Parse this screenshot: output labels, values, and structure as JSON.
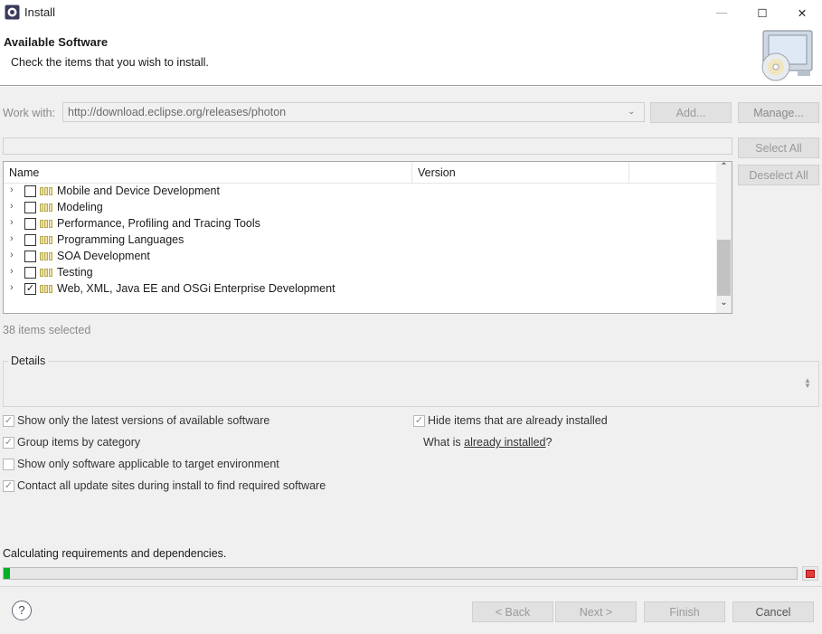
{
  "window": {
    "title": "Install",
    "minimize_glyph": "—",
    "maximize_glyph": "☐",
    "close_glyph": "✕"
  },
  "header": {
    "title": "Available Software",
    "subtitle": "Check the items that you wish to install."
  },
  "work_with": {
    "label": "Work with:",
    "value": "http://download.eclipse.org/releases/photon",
    "add_label": "Add...",
    "manage_label": "Manage..."
  },
  "filter": {
    "placeholder": ""
  },
  "buttons": {
    "select_all": "Select All",
    "deselect_all": "Deselect All"
  },
  "table": {
    "columns": [
      "Name",
      "Version",
      ""
    ],
    "rows": [
      {
        "label": "Mobile and Device Development",
        "checked": false
      },
      {
        "label": "Modeling",
        "checked": false
      },
      {
        "label": "Performance, Profiling and Tracing Tools",
        "checked": false
      },
      {
        "label": "Programming Languages",
        "checked": false
      },
      {
        "label": "SOA Development",
        "checked": false
      },
      {
        "label": "Testing",
        "checked": false
      },
      {
        "label": "Web, XML, Java EE and OSGi Enterprise Development",
        "checked": true
      }
    ]
  },
  "selected_count": "38 items selected",
  "details": {
    "label": "Details"
  },
  "options": {
    "latest": {
      "label": "Show only the latest versions of available software",
      "checked": true
    },
    "group": {
      "label": "Group items by category",
      "checked": true
    },
    "target": {
      "label": "Show only software applicable to target environment",
      "checked": false
    },
    "contact": {
      "label": "Contact all update sites during install to find required software",
      "checked": true
    },
    "hide": {
      "label": "Hide items that are already installed",
      "checked": true
    }
  },
  "what_installed": {
    "prefix": "What is ",
    "link": "already installed",
    "suffix": "?"
  },
  "status": {
    "text": "Calculating requirements and dependencies.",
    "progress": 0.008
  },
  "footer": {
    "help": "?",
    "back": "< Back",
    "next": "Next >",
    "finish": "Finish",
    "cancel": "Cancel"
  },
  "icons": {
    "app": "eclipse-install-icon",
    "header": "computer-cd-icon",
    "expand": "chevron-right-icon",
    "package": "package-icon",
    "stop": "stop-icon",
    "help": "help-icon"
  },
  "colors": {
    "progress_fill": "#06b025",
    "stop": "#e23b3b"
  }
}
